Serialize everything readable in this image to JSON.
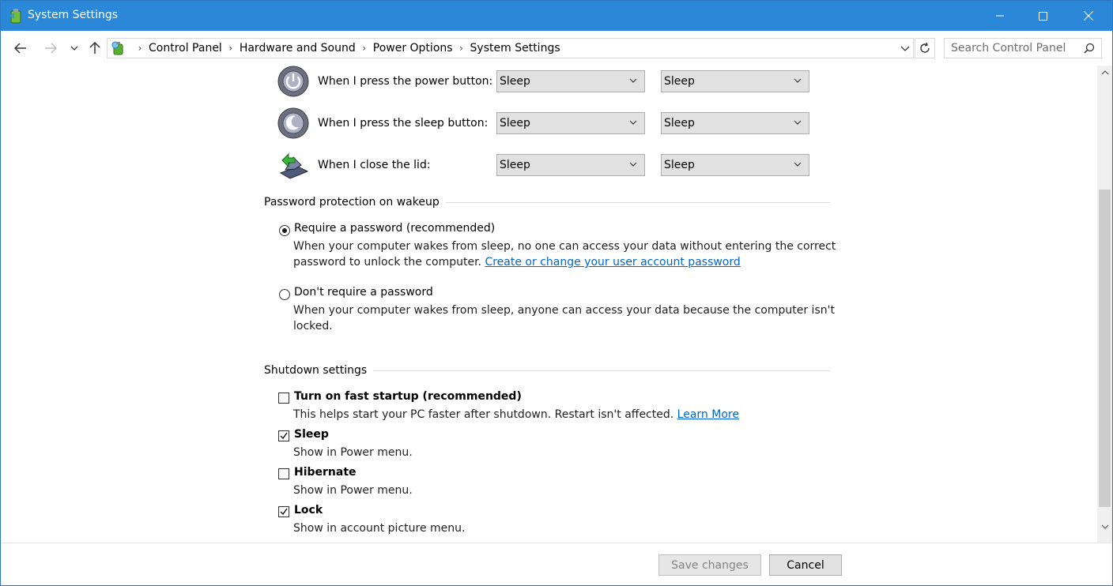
{
  "window": {
    "title": "System Settings"
  },
  "nav": {
    "breadcrumbs": [
      "Control Panel",
      "Hardware and Sound",
      "Power Options",
      "System Settings"
    ],
    "search_placeholder": "Search Control Panel"
  },
  "power_buttons": {
    "rows": [
      {
        "label": "When I press the power button:",
        "on_battery": "Sleep",
        "plugged_in": "Sleep"
      },
      {
        "label": "When I press the sleep button:",
        "on_battery": "Sleep",
        "plugged_in": "Sleep"
      },
      {
        "label": "When I close the lid:",
        "on_battery": "Sleep",
        "plugged_in": "Sleep"
      }
    ]
  },
  "password": {
    "title": "Password protection on wakeup",
    "require_label": "Require a password (recommended)",
    "require_desc_line1": "When your computer wakes from sleep, no one can access your data without entering the correct",
    "require_desc_line2": "password to unlock the computer.",
    "require_link": "Create or change your user account password",
    "dont_label": "Don't require a password",
    "dont_desc_line1": "When your computer wakes from sleep, anyone can access your data because the computer isn't",
    "dont_desc_line2": "locked.",
    "selected": "require"
  },
  "shutdown": {
    "title": "Shutdown settings",
    "fast_startup": {
      "label": "Turn on fast startup (recommended)",
      "desc": "This helps start your PC faster after shutdown. Restart isn't affected.",
      "link": "Learn More",
      "checked": false
    },
    "sleep": {
      "label": "Sleep",
      "desc": "Show in Power menu.",
      "checked": true
    },
    "hibernate": {
      "label": "Hibernate",
      "desc": "Show in Power menu.",
      "checked": false
    },
    "lock": {
      "label": "Lock",
      "desc": "Show in account picture menu.",
      "checked": true
    }
  },
  "footer": {
    "save_label": "Save changes",
    "cancel_label": "Cancel"
  },
  "colors": {
    "titlebar": "#2b88d8",
    "link": "#0066cc"
  }
}
